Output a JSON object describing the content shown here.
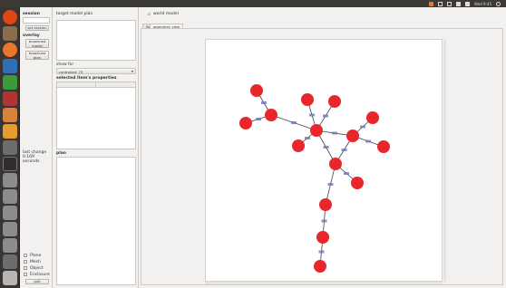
{
  "top_panel": {
    "clock": "Wed 9:45"
  },
  "left_panel": {
    "title": "session",
    "buttons": [
      "set session",
      "overlay",
      "broadcast model",
      "broadcast plan"
    ],
    "stat": "last change 0.169 seconds",
    "checkboxes": [
      {
        "label": "Plane",
        "checked": false
      },
      {
        "label": "Mesh",
        "checked": false
      },
      {
        "label": "Object",
        "checked": false
      },
      {
        "label": "Enclosure",
        "checked": false
      }
    ],
    "quit_label": "quit"
  },
  "middle_panel": {
    "header": "target model plan",
    "show_for_label": "show for",
    "select_value": "controlled: 73",
    "properties_header": "selected item's properties",
    "prop_columns": [
      "",
      ""
    ],
    "plan_label": "plan"
  },
  "main": {
    "toolbar": "world model",
    "tabs": [
      "list",
      "geometric view"
    ]
  },
  "graph": {
    "node_color": "#e8262b",
    "edge_color": "#444444",
    "label_color": "#6f77b9"
  }
}
